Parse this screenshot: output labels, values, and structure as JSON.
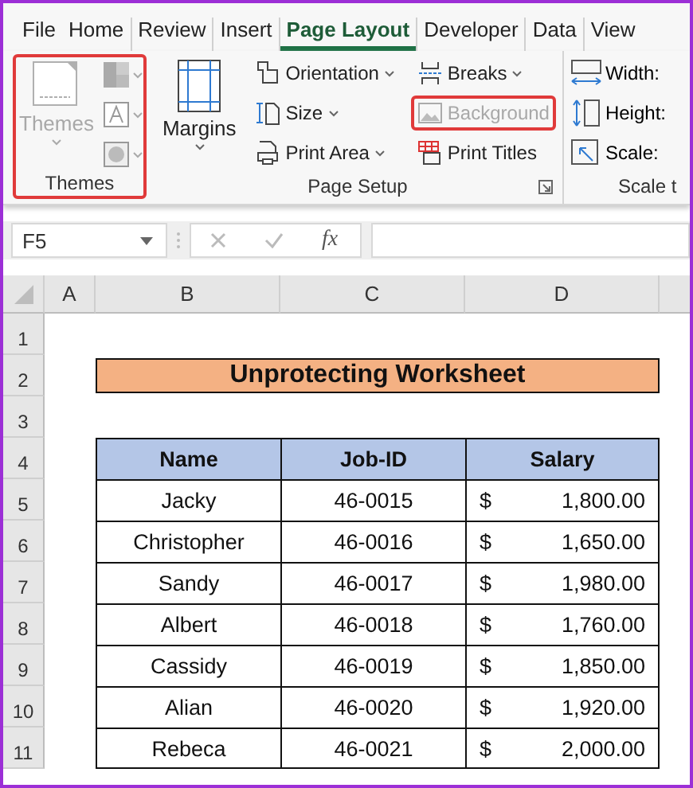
{
  "tabs": [
    {
      "label": "File",
      "selected": false
    },
    {
      "label": "Home",
      "selected": false
    },
    {
      "label": "Review",
      "selected": false
    },
    {
      "label": "Insert",
      "selected": false
    },
    {
      "label": "Page Layout",
      "selected": true
    },
    {
      "label": "Developer",
      "selected": false
    },
    {
      "label": "Data",
      "selected": false
    },
    {
      "label": "View",
      "selected": false
    }
  ],
  "themes_group": {
    "label": "Themes",
    "highlighted": true,
    "themes_button": {
      "label": "Themes",
      "disabled": true
    }
  },
  "page_setup_group": {
    "label": "Page Setup",
    "margins": {
      "label": "Margins"
    },
    "buttons": [
      {
        "kind": "orientation",
        "label": "Orientation",
        "caret": true,
        "disabled": false,
        "highlighted": false
      },
      {
        "kind": "size",
        "label": "Size",
        "caret": true,
        "disabled": false,
        "highlighted": false
      },
      {
        "kind": "print-area",
        "label": "Print Area",
        "caret": true,
        "disabled": false,
        "highlighted": false
      },
      {
        "kind": "breaks",
        "label": "Breaks",
        "caret": true,
        "disabled": false,
        "highlighted": false
      },
      {
        "kind": "background",
        "label": "Background",
        "caret": false,
        "disabled": true,
        "highlighted": true
      },
      {
        "kind": "print-titles",
        "label": "Print Titles",
        "caret": false,
        "disabled": false,
        "highlighted": false
      }
    ]
  },
  "scale_group": {
    "label": "Scale t",
    "items": [
      {
        "kind": "width",
        "label": "Width:"
      },
      {
        "kind": "height",
        "label": "Height:"
      },
      {
        "kind": "scale",
        "label": "Scale:"
      }
    ]
  },
  "formula_bar": {
    "name_box": "F5",
    "fx": "fx"
  },
  "sheet": {
    "columns": [
      "A",
      "B",
      "C",
      "D"
    ],
    "rows": [
      "1",
      "2",
      "3",
      "4",
      "5",
      "6",
      "7",
      "8",
      "9",
      "10",
      "11"
    ],
    "title": "Unprotecting Worksheet",
    "table": {
      "columns": [
        "Name",
        "Job-ID",
        "Salary"
      ],
      "rows": [
        {
          "name": "Jacky",
          "job_id": "46-0015",
          "currency": "$",
          "salary": "1,800.00"
        },
        {
          "name": "Christopher",
          "job_id": "46-0016",
          "currency": "$",
          "salary": "1,650.00"
        },
        {
          "name": "Sandy",
          "job_id": "46-0017",
          "currency": "$",
          "salary": "1,980.00"
        },
        {
          "name": "Albert",
          "job_id": "46-0018",
          "currency": "$",
          "salary": "1,760.00"
        },
        {
          "name": "Cassidy",
          "job_id": "46-0019",
          "currency": "$",
          "salary": "1,850.00"
        },
        {
          "name": "Alian",
          "job_id": "46-0020",
          "currency": "$",
          "salary": "1,920.00"
        },
        {
          "name": "Rebeca",
          "job_id": "46-0021",
          "currency": "$",
          "salary": "2,000.00"
        }
      ]
    }
  }
}
